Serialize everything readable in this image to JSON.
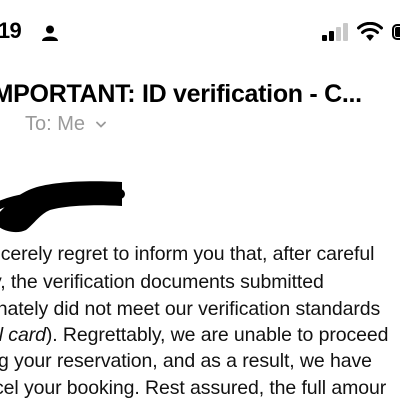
{
  "status_bar": {
    "time": ":19",
    "icons": [
      "person-icon",
      "signal-icon",
      "wifi-icon",
      "battery-icon"
    ]
  },
  "email": {
    "subject": "IMPORTANT: ID verification - C...",
    "recipient": "To: Me",
    "body_lines": [
      "ncerely regret to inform you that, after careful",
      "y, the verification documents submitted",
      "unately did not meet our verification standards",
      "). Regrettably, we are unable to proceed",
      "ing your reservation, and as a result, we have",
      "cel your booking. Rest assured, the full amour"
    ],
    "italic_fragment": "al card"
  },
  "colors": {
    "background": "#ffffff",
    "text": "#111111",
    "muted": "#9a9a9a"
  }
}
